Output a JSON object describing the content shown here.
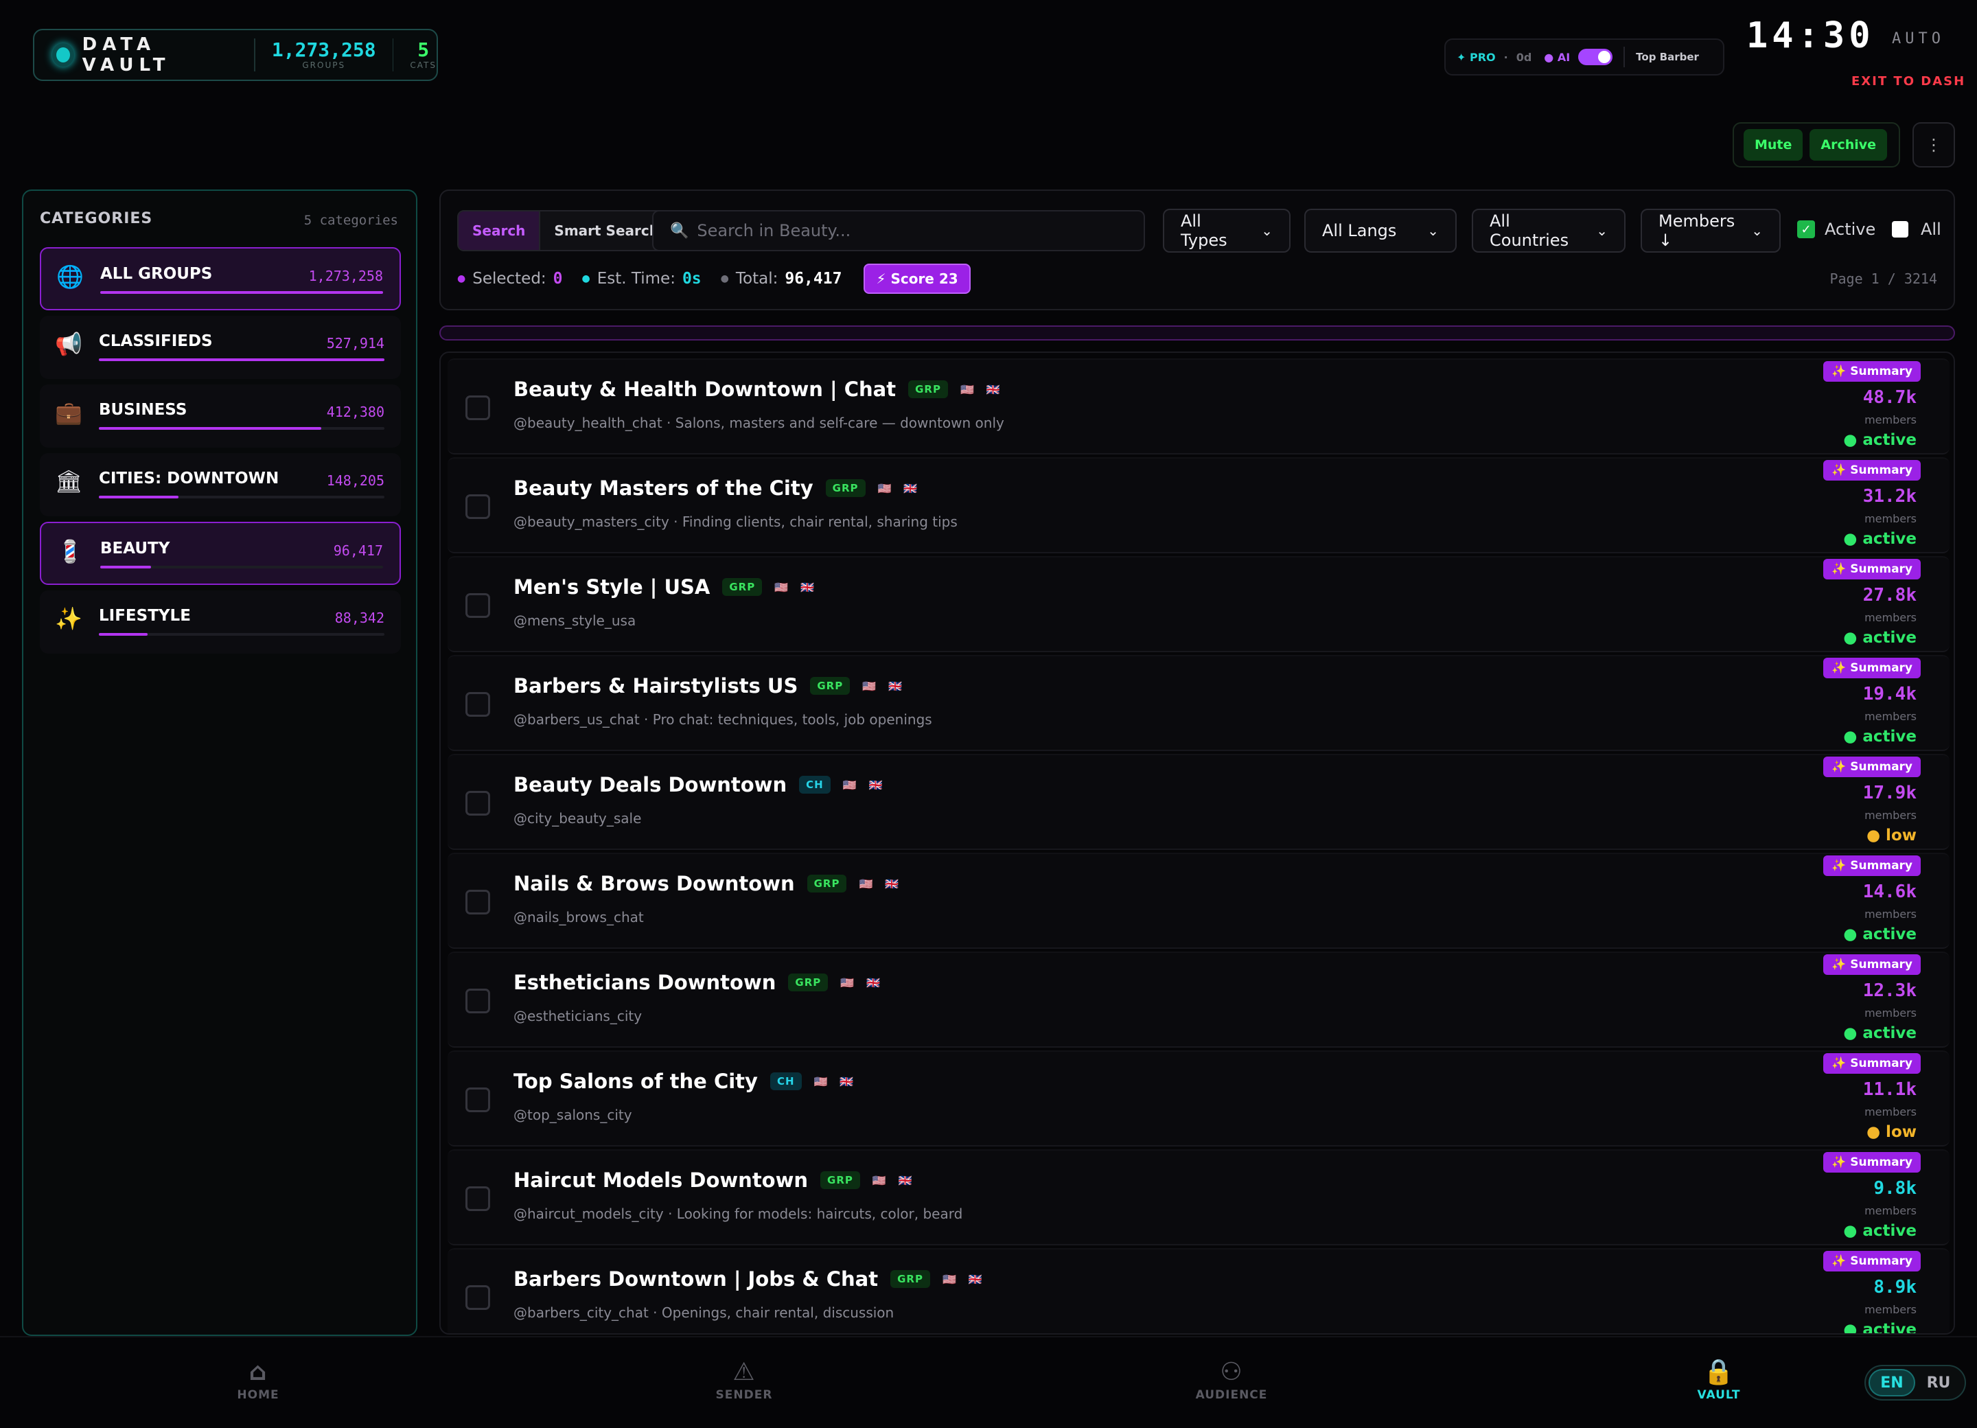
{
  "brand": {
    "title": "DATA VAULT",
    "groups_count": "1,273,258",
    "groups_label": "GROUPS",
    "cats_count": "5",
    "cats_label": "CATS"
  },
  "status": {
    "pro": "✦ PRO",
    "separator": "·",
    "days": "0d",
    "ai": "● AI",
    "ai_enabled": true,
    "profile": "Top Barber"
  },
  "clock": {
    "time": "14:30",
    "mode": "AUTO",
    "exit": "EXIT TO DASH"
  },
  "actions": {
    "mute": "Mute",
    "archive": "Archive",
    "more": "⋮"
  },
  "sidebar": {
    "title": "CATEGORIES",
    "count_label": "5 categories",
    "items": [
      {
        "icon": "globe-icon",
        "glyph": "🌐",
        "label": "ALL GROUPS",
        "count": "1,273,258",
        "fill": 1.0,
        "selected": true
      },
      {
        "icon": "megaphone-icon",
        "glyph": "📢",
        "label": "CLASSIFIEDS",
        "count": "527,914",
        "fill": 1.0,
        "selected": false
      },
      {
        "icon": "briefcase-icon",
        "glyph": "💼",
        "label": "BUSINESS",
        "count": "412,380",
        "fill": 0.78,
        "selected": false
      },
      {
        "icon": "building-icon",
        "glyph": "🏛",
        "label": "CITIES: DOWNTOWN",
        "count": "148,205",
        "fill": 0.28,
        "selected": false
      },
      {
        "icon": "barber-pole-icon",
        "glyph": "💈",
        "label": "BEAUTY",
        "count": "96,417",
        "fill": 0.18,
        "selected": true
      },
      {
        "icon": "sparkles-icon",
        "glyph": "✨",
        "label": "LIFESTYLE",
        "count": "88,342",
        "fill": 0.17,
        "selected": false
      }
    ]
  },
  "filters": {
    "tab_search": "Search",
    "tab_smart": "Smart Search",
    "search_placeholder": "Search in Beauty...",
    "types": "All Types",
    "langs": "All Langs",
    "countries": "All Countries",
    "sort": "Members ↓",
    "active_label": "Active",
    "active_checked": true,
    "all_label": "All",
    "all_checked": false,
    "selected_label": "Selected:",
    "selected_value": "0",
    "est_label": "Est. Time:",
    "est_value": "0s",
    "total_label": "Total:",
    "total_value": "96,417",
    "score": "⚡ Score 23",
    "page": "Page 1 / 3214"
  },
  "groups": [
    {
      "title": "Beauty & Health Downtown | Chat",
      "type": "GRP",
      "sub": "@beauty_health_chat · Salons, masters and self-care — downtown only",
      "summary": "✨ Summary",
      "members": "48.7k",
      "members_label": "members",
      "state": "● active"
    },
    {
      "title": "Beauty Masters of the City",
      "type": "GRP",
      "sub": "@beauty_masters_city · Finding clients, chair rental, sharing tips",
      "summary": "✨ Summary",
      "members": "31.2k",
      "members_label": "members",
      "state": "● active"
    },
    {
      "title": "Men's Style | USA",
      "type": "GRP",
      "sub": "@mens_style_usa",
      "summary": "✨ Summary",
      "members": "27.8k",
      "members_label": "members",
      "state": "● active"
    },
    {
      "title": "Barbers & Hairstylists US",
      "type": "GRP",
      "sub": "@barbers_us_chat · Pro chat: techniques, tools, job openings",
      "summary": "✨ Summary",
      "members": "19.4k",
      "members_label": "members",
      "state": "● active"
    },
    {
      "title": "Beauty Deals Downtown",
      "type": "CH",
      "sub": "@city_beauty_sale",
      "summary": "✨ Summary",
      "members": "17.9k",
      "members_label": "members",
      "state": "● low"
    },
    {
      "title": "Nails & Brows Downtown",
      "type": "GRP",
      "sub": "@nails_brows_chat",
      "summary": "✨ Summary",
      "members": "14.6k",
      "members_label": "members",
      "state": "● active"
    },
    {
      "title": "Estheticians Downtown",
      "type": "GRP",
      "sub": "@estheticians_city",
      "summary": "✨ Summary",
      "members": "12.3k",
      "members_label": "members",
      "state": "● active"
    },
    {
      "title": "Top Salons of the City",
      "type": "CH",
      "sub": "@top_salons_city",
      "summary": "✨ Summary",
      "members": "11.1k",
      "members_label": "members",
      "state": "● low"
    },
    {
      "title": "Haircut Models Downtown",
      "type": "GRP",
      "sub": "@haircut_models_city · Looking for models: haircuts, color, beard",
      "summary": "✨ Summary",
      "members": "9.8k",
      "members_label": "members",
      "state": "● active"
    },
    {
      "title": "Barbers Downtown | Jobs & Chat",
      "type": "GRP",
      "sub": "@barbers_city_chat · Openings, chair rental, discussion",
      "summary": "✨ Summary",
      "members": "8.9k",
      "members_label": "members",
      "state": "● active"
    }
  ],
  "flags": {
    "us": "🇺🇸",
    "uk": "🇬🇧"
  },
  "nav": {
    "home": "HOME",
    "sender": "SENDER",
    "audience": "AUDIENCE",
    "vault": "VAULT",
    "lang_en": "EN",
    "lang_ru": "RU"
  },
  "colors": {
    "accent_purple": "#b334f0",
    "accent_cyan": "#14c8c8",
    "accent_green": "#3bff6a",
    "active_green": "#2ee86a",
    "low_amber": "#f3b52a",
    "exit_red": "#ff3b4a"
  }
}
